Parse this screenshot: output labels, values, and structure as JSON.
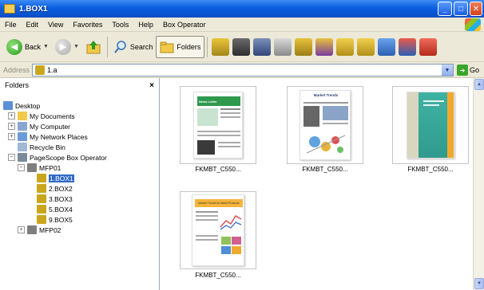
{
  "window": {
    "title": "1.BOX1"
  },
  "menu": [
    "File",
    "Edit",
    "View",
    "Favorites",
    "Tools",
    "Help",
    "Box Operator"
  ],
  "toolbar": {
    "back_label": "Back",
    "search_label": "Search",
    "folders_label": "Folders",
    "action_icons": [
      "box-icon",
      "scan-icon",
      "save-icon",
      "settings-icon",
      "export-icon",
      "import-icon",
      "copy-icon",
      "move-icon",
      "refresh-icon",
      "sync-icon",
      "delete-icon"
    ]
  },
  "address": {
    "label": "Address",
    "value": "1.a",
    "go_label": "Go"
  },
  "folders_pane": {
    "title": "Folders",
    "close_label": "×",
    "items": [
      {
        "label": "Desktop",
        "icon": "desktop-icon"
      },
      {
        "label": "My Documents",
        "icon": "my-documents-icon"
      },
      {
        "label": "My Computer",
        "icon": "my-computer-icon"
      },
      {
        "label": "My Network Places",
        "icon": "network-places-icon"
      },
      {
        "label": "Recycle Bin",
        "icon": "recycle-bin-icon"
      },
      {
        "label": "PageScope Box Operator",
        "icon": "box-operator-icon"
      },
      {
        "label": "MFP01",
        "icon": "mfp-icon"
      },
      {
        "label": "1.BOX1",
        "icon": "box-icon"
      },
      {
        "label": "2.BOX2",
        "icon": "box-icon"
      },
      {
        "label": "3.BOX3",
        "icon": "box-icon"
      },
      {
        "label": "5.BOX4",
        "icon": "box-icon"
      },
      {
        "label": "9.BOX5",
        "icon": "box-icon"
      },
      {
        "label": "MFP02",
        "icon": "mfp-icon"
      }
    ]
  },
  "files": [
    {
      "name": "FKMBT_C550...",
      "doc_title": "News Letter"
    },
    {
      "name": "FKMBT_C550...",
      "doc_title": "Market Trends"
    },
    {
      "name": "FKMBT_C550...",
      "doc_title": ""
    },
    {
      "name": "FKMBT_C550...",
      "doc_title": "Market Trends for latest Products"
    }
  ],
  "colors": {
    "titlebar": "#0a5fe0",
    "chrome": "#ece9d8",
    "selection": "#316ac5"
  }
}
